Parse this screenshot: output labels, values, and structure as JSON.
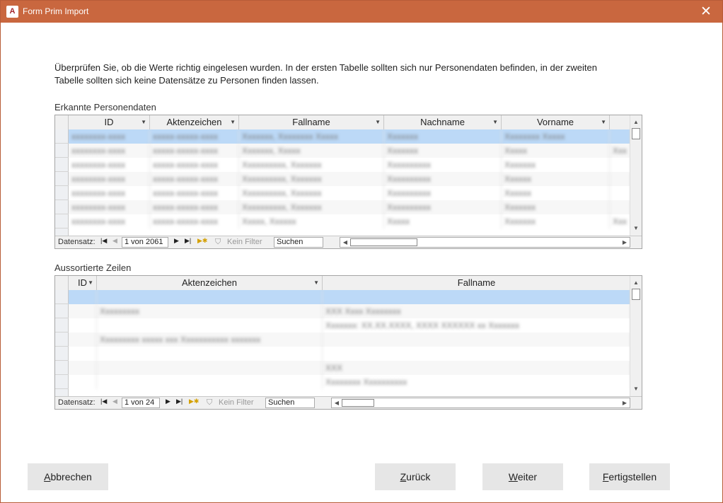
{
  "window": {
    "title": "Form Prim Import",
    "app_icon_text": "A",
    "close_glyph": "✕"
  },
  "instruction": "Überprüfen Sie, ob die Werte richtig eingelesen wurden. In der ersten Tabelle sollten sich nur Personendaten befinden, in der zweiten Tabelle sollten sich keine Datensätze zu Personen finden lassen.",
  "persons": {
    "label": "Erkannte Personendaten",
    "columns": [
      "ID",
      "Aktenzeichen",
      "Fallname",
      "Nachname",
      "Vorname"
    ],
    "rows": [
      [
        "xxxxxxxx-xxxx",
        "xxxxx-xxxxx-xxxx",
        "Xxxxxxx, Xxxxxxxx Xxxxx",
        "Xxxxxxx",
        "Xxxxxxxx Xxxxx",
        ""
      ],
      [
        "xxxxxxxx-xxxx",
        "xxxxx-xxxxx-xxxx",
        "Xxxxxxx, Xxxxx",
        "Xxxxxxx",
        "Xxxxx",
        "Xxx"
      ],
      [
        "xxxxxxxx-xxxx",
        "xxxxx-xxxxx-xxxx",
        "Xxxxxxxxxx, Xxxxxxx",
        "Xxxxxxxxxx",
        "Xxxxxxx",
        ""
      ],
      [
        "xxxxxxxx-xxxx",
        "xxxxx-xxxxx-xxxx",
        "Xxxxxxxxxx, Xxxxxxx",
        "Xxxxxxxxxx",
        "Xxxxxx",
        ""
      ],
      [
        "xxxxxxxx-xxxx",
        "xxxxx-xxxxx-xxxx",
        "Xxxxxxxxxx, Xxxxxxx",
        "Xxxxxxxxxx",
        "Xxxxxx",
        ""
      ],
      [
        "xxxxxxxx-xxxx",
        "xxxxx-xxxxx-xxxx",
        "Xxxxxxxxxx, Xxxxxxx",
        "Xxxxxxxxxx",
        "Xxxxxxx",
        ""
      ],
      [
        "xxxxxxxx-xxxx",
        "xxxxx-xxxxx-xxxx",
        "Xxxxx, Xxxxxx",
        "Xxxxx",
        "Xxxxxxx",
        "Xxx"
      ]
    ],
    "nav": {
      "label": "Datensatz:",
      "record": "1 von 2061",
      "filter": "Kein Filter",
      "search": "Suchen"
    }
  },
  "leftover": {
    "label": "Aussortierte Zeilen",
    "columns": [
      "ID",
      "Aktenzeichen",
      "Fallname"
    ],
    "rows": [
      [
        "",
        "",
        ""
      ],
      [
        "",
        "Xxxxxxxxx",
        "XXX Xxxx Xxxxxxxx"
      ],
      [
        "",
        "",
        "Xxxxxxx: XX.XX.XXXX, XXXX XXXXXX xx Xxxxxxx"
      ],
      [
        "",
        "Xxxxxxxxx xxxxx xxx Xxxxxxxxxxx xxxxxxx",
        ""
      ],
      [
        "",
        "",
        ""
      ],
      [
        "",
        "",
        "XXX"
      ],
      [
        "",
        "",
        "Xxxxxxxx Xxxxxxxxxx"
      ]
    ],
    "nav": {
      "label": "Datensatz:",
      "record": "1 von 24",
      "filter": "Kein Filter",
      "search": "Suchen"
    }
  },
  "buttons": {
    "cancel": {
      "mnemonic": "A",
      "rest": "bbrechen"
    },
    "back": {
      "mnemonic": "Z",
      "rest": "urück"
    },
    "next": {
      "mnemonic": "W",
      "rest": "eiter"
    },
    "finish": {
      "mnemonic": "F",
      "rest": "ertigstellen"
    }
  },
  "colors": {
    "titlebar": "#c9673f",
    "selected_row": "#bcd9f7"
  }
}
